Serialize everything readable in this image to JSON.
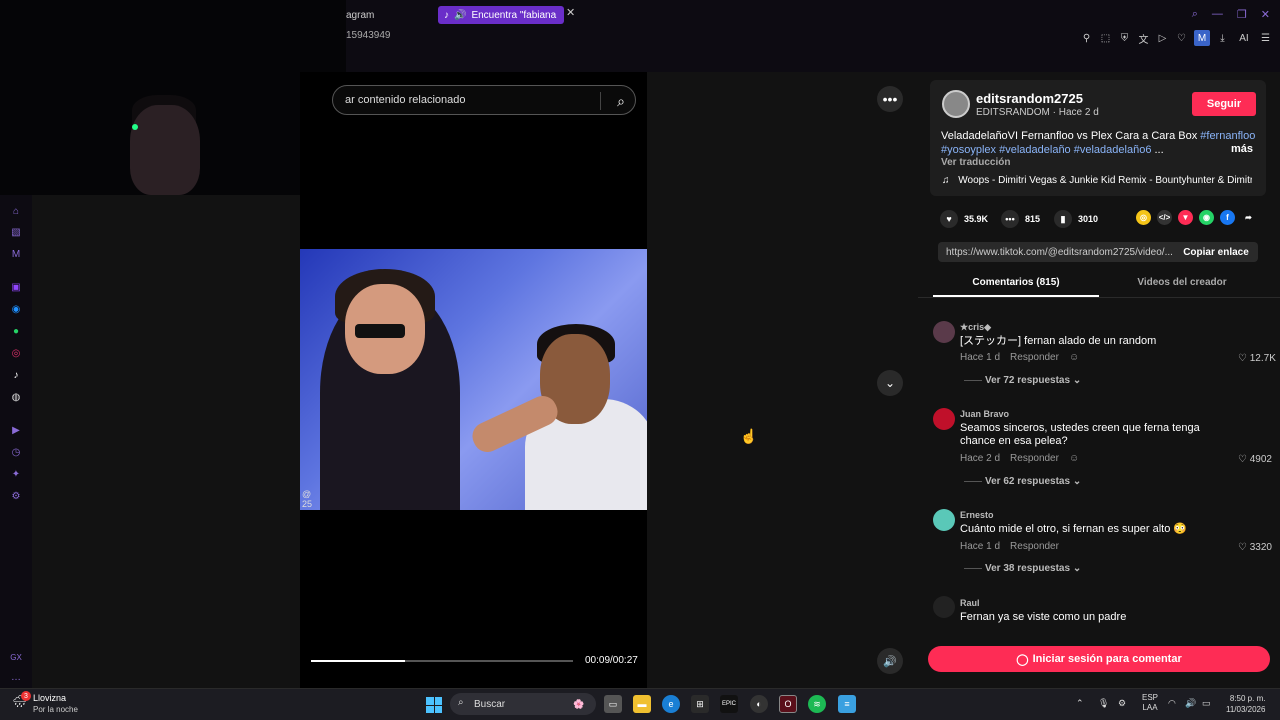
{
  "browser": {
    "tab_partial": "agram",
    "active_tab": "Encuentra \"fabiana se",
    "url_fragment": "15943949",
    "toolbar_ai": "AI",
    "toolbar_badge": "M"
  },
  "video": {
    "search_placeholder": "ar contenido relacionado",
    "watermark_top": "@",
    "watermark_bottom": "25",
    "time": "00:09/00:27",
    "progress_fraction": 0.36
  },
  "post": {
    "username": "editsrandom2725",
    "subline": "EDITSRANDOM · Hace 2 d",
    "follow_label": "Seguir",
    "desc_text": "VeladadelañoVI Fernanfloo vs Plex Cara a Cara Box ",
    "tag1": "#fernanfloo",
    "tag2": "#yosoyplex",
    "tag3": "#veladadelaño",
    "tag4": "#veladadelaño6",
    "ellipsis": "...",
    "more": "más",
    "translate": "Ver traducción",
    "music": "Woops - Dimitri Vegas & Junkie Kid Remix - Bountyhunter & Dimitri...",
    "likes": "35.9K",
    "comments": "815",
    "saves": "3010",
    "url": "https://www.tiktok.com/@editsrandom2725/video/...",
    "copy_label": "Copiar enlace"
  },
  "tabs": {
    "comments": "Comentarios (815)",
    "videos": "Videos del creador"
  },
  "comments": [
    {
      "user": "★cris◆",
      "text": "[ステッカー] fernan alado de un random",
      "time": "Hace 1 d",
      "reply": "Responder",
      "likes": "12.7K",
      "replies": "Ver 72 respuestas",
      "color": "#5a3a4a"
    },
    {
      "user": "Juan Bravo",
      "text": "Seamos sinceros, ustedes creen que ferna tenga chance en esa pelea?",
      "time": "Hace 2 d",
      "reply": "Responder",
      "likes": "4902",
      "replies": "Ver 62 respuestas",
      "color": "#c0102a"
    },
    {
      "user": "Ernesto",
      "text": "Cuánto mide el otro, si fernan es super alto 😳",
      "time": "Hace 1 d",
      "reply": "Responder",
      "likes": "3320",
      "replies": "Ver 38 respuestas",
      "color": "#5ac8b8"
    },
    {
      "user": "Raul",
      "text": "Fernan ya se viste como un padre",
      "time": "",
      "reply": "",
      "likes": "",
      "replies": "",
      "color": "#222222"
    }
  ],
  "login_label": "Iniciar sesión para comentar",
  "taskbar": {
    "weather_title": "Llovizna",
    "weather_sub": "Por la noche",
    "weather_badge": "3",
    "search": "Buscar",
    "lang_top": "ESP",
    "lang_bottom": "LAA",
    "time": "8:50 p. m.",
    "date": "11/03/2026"
  },
  "colors": {
    "accent": "#fe2c55",
    "tag": "#8ab4f8",
    "browser_accent": "#6a2ec9"
  }
}
